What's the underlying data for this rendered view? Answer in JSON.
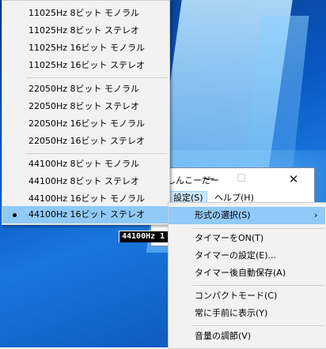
{
  "app": {
    "title": "しんこーだー",
    "minimize": "—",
    "maximize": "☐",
    "close": "✕",
    "menubar": {
      "settings": "設定(S)",
      "help": "ヘルプ(H)"
    },
    "display": "44100Hz 1"
  },
  "format_menu": {
    "items": [
      "11025Hz 8ビット モノラル",
      "11025Hz 8ビット ステレオ",
      "11025Hz 16ビット モノラル",
      "11025Hz 16ビット ステレオ",
      "22050Hz 8ビット モノラル",
      "22050Hz 8ビット ステレオ",
      "22050Hz 16ビット モノラル",
      "22050Hz 16ビット ステレオ",
      "44100Hz 8ビット モノラル",
      "44100Hz 8ビット ステレオ",
      "44100Hz 16ビット モノラル",
      "44100Hz 16ビット ステレオ"
    ],
    "selected_index": 11
  },
  "settings_menu": {
    "format_select": "形式の選択(S)",
    "format_arrow": "›",
    "timer_on": "タイマーをON(T)",
    "timer_settings": "タイマーの設定(E)...",
    "timer_autosave": "タイマー後自動保存(A)",
    "compact_mode": "コンパクトモード(C)",
    "always_on_top": "常に手前に表示(Y)",
    "volume": "音量の調節(V)"
  },
  "colors": {
    "menu_background": "#f2f2f2",
    "highlight": "#91c9f7",
    "desktop_blue": "#0a58c4"
  }
}
